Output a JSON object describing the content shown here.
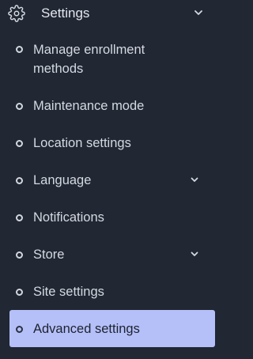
{
  "colors": {
    "background": "#212733",
    "text": "#d4d9e1",
    "active_background": "#b5c0f8",
    "active_text": "#1d2230"
  },
  "header": {
    "icon": "gear-icon",
    "label": "Settings",
    "chevron": "chevron-down-icon"
  },
  "menu": {
    "items": [
      {
        "label": "Manage enrollment methods",
        "icon": "circle-bullet-icon"
      },
      {
        "label": "Maintenance mode",
        "icon": "circle-bullet-icon"
      },
      {
        "label": "Location settings",
        "icon": "circle-bullet-icon"
      },
      {
        "label": "Language",
        "icon": "circle-bullet-icon",
        "expandable": true
      },
      {
        "label": "Notifications",
        "icon": "circle-bullet-icon"
      },
      {
        "label": "Store",
        "icon": "circle-bullet-icon",
        "expandable": true
      },
      {
        "label": "Site settings",
        "icon": "circle-bullet-icon"
      },
      {
        "label": "Advanced settings",
        "icon": "circle-bullet-icon",
        "active": true
      }
    ]
  }
}
